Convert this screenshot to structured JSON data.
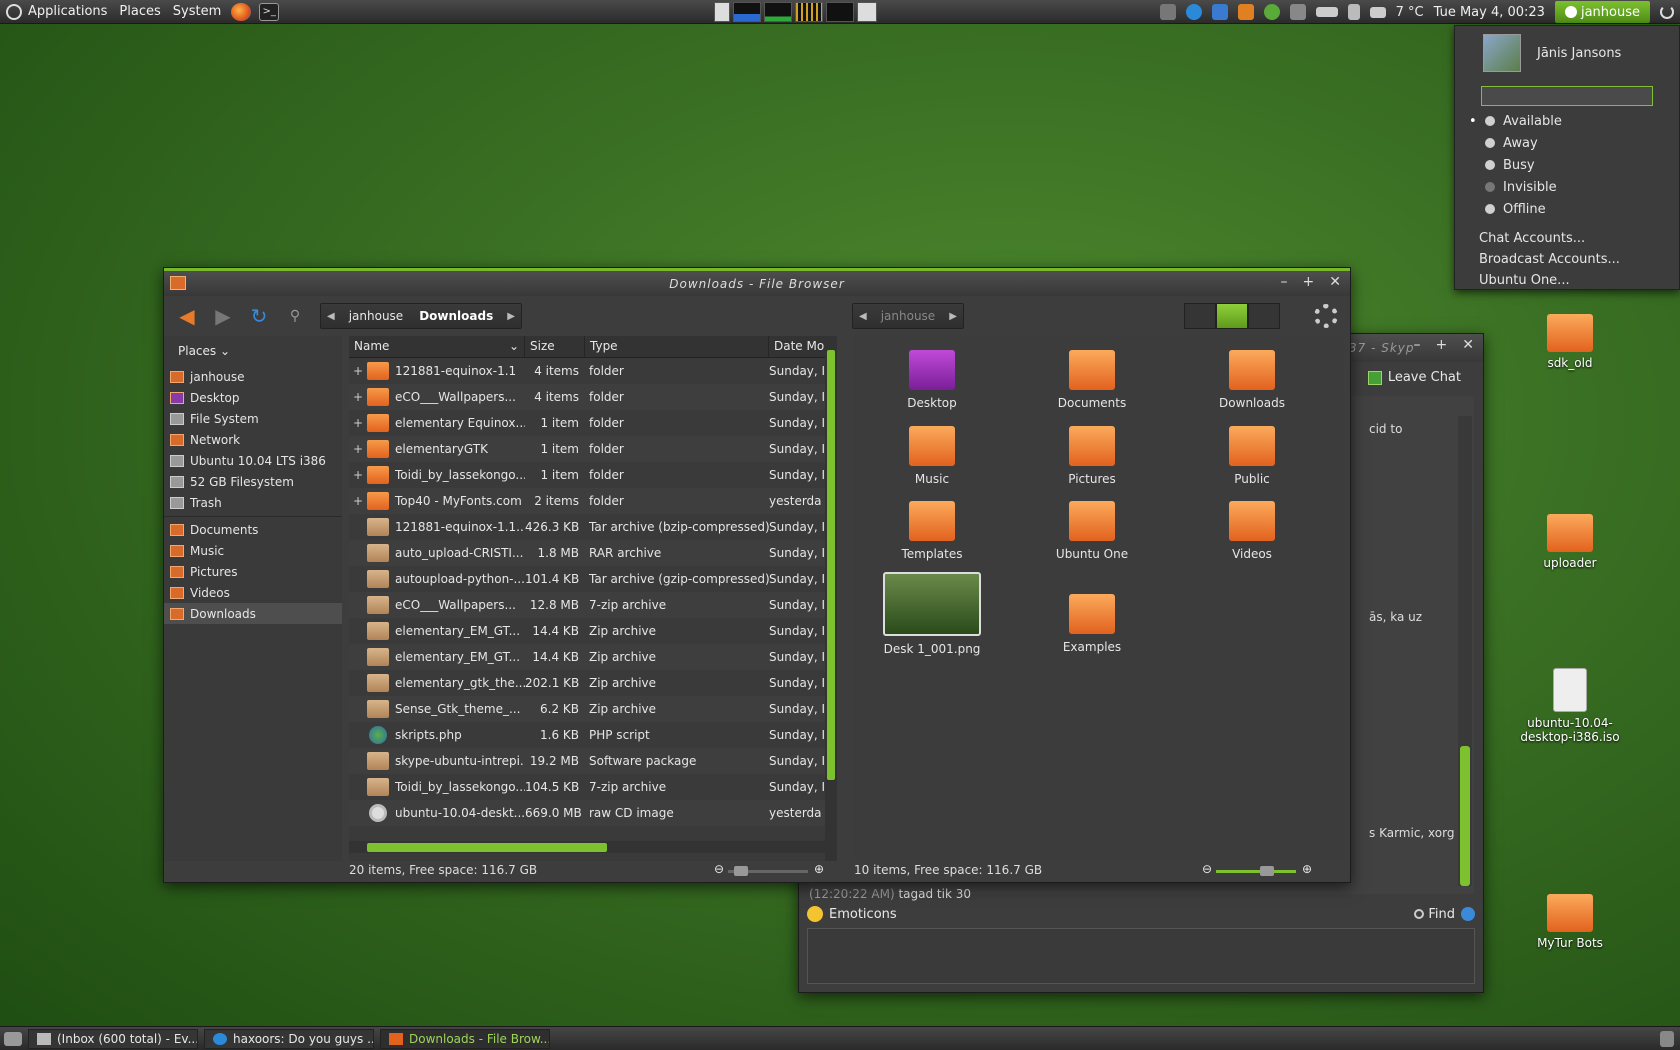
{
  "top_panel": {
    "menus": [
      "Applications",
      "Places",
      "System"
    ],
    "temperature": "7 °C",
    "clock": "Tue May 4, 00:23",
    "user": "janhouse"
  },
  "status_menu": {
    "name": "Jānis Jansons",
    "input_value": "",
    "statuses": [
      "Available",
      "Away",
      "Busy",
      "Invisible",
      "Offline"
    ],
    "selected_status": "Available",
    "links": [
      "Chat Accounts...",
      "Broadcast Accounts...",
      "Ubuntu One..."
    ]
  },
  "skype": {
    "title_fragment": "37 - Skyp",
    "leave_chat": "Leave Chat",
    "snippets": [
      "cid to",
      "ās, ka uz",
      "s Karmic, xorg"
    ],
    "timestamp": "(12:20:22 AM)",
    "last_message": "tagad tik 30",
    "emoticons": "Emoticons",
    "find": "Find"
  },
  "file_browser": {
    "title": "Downloads - File Browser",
    "breadcrumb_left": [
      "janhouse",
      "Downloads"
    ],
    "breadcrumb_right": [
      "janhouse"
    ],
    "places_label": "Places",
    "places": [
      {
        "label": "janhouse",
        "icon": "home-folder-icon"
      },
      {
        "label": "Desktop",
        "icon": "desktop-folder-icon"
      },
      {
        "label": "File System",
        "icon": "filesystem-icon"
      },
      {
        "label": "Network",
        "icon": "network-icon"
      },
      {
        "label": "Ubuntu 10.04 LTS i386",
        "icon": "drive-icon"
      },
      {
        "label": "52 GB Filesystem",
        "icon": "drive-icon"
      },
      {
        "label": "Trash",
        "icon": "trash-icon"
      }
    ],
    "bookmarks": [
      {
        "label": "Documents"
      },
      {
        "label": "Music"
      },
      {
        "label": "Pictures"
      },
      {
        "label": "Videos"
      },
      {
        "label": "Downloads"
      }
    ],
    "columns": [
      "Name",
      "Size",
      "Type",
      "Date Mo"
    ],
    "rows": [
      {
        "name": "121881-equinox-1.1",
        "size": "4 items",
        "type": "folder",
        "date": "Sunday, I",
        "kind": "folder"
      },
      {
        "name": "eCO___Wallpapers...",
        "size": "4 items",
        "type": "folder",
        "date": "Sunday, I",
        "kind": "folder"
      },
      {
        "name": "elementary Equinox...",
        "size": "1 item",
        "type": "folder",
        "date": "Sunday, I",
        "kind": "folder"
      },
      {
        "name": "elementaryGTK",
        "size": "1 item",
        "type": "folder",
        "date": "Sunday, I",
        "kind": "folder"
      },
      {
        "name": "Toidi_by_lassekongo...",
        "size": "1 item",
        "type": "folder",
        "date": "Sunday, I",
        "kind": "folder"
      },
      {
        "name": "Top40 - MyFonts.com",
        "size": "2 items",
        "type": "folder",
        "date": "yesterda",
        "kind": "folder"
      },
      {
        "name": "121881-equinox-1.1....",
        "size": "426.3 KB",
        "type": "Tar archive (bzip-compressed)",
        "date": "Sunday, I",
        "kind": "archive"
      },
      {
        "name": "auto_upload-CRISTI...",
        "size": "1.8 MB",
        "type": "RAR archive",
        "date": "Sunday, I",
        "kind": "archive"
      },
      {
        "name": "autoupload-python-...",
        "size": "101.4 KB",
        "type": "Tar archive (gzip-compressed)",
        "date": "Sunday, I",
        "kind": "archive"
      },
      {
        "name": "eCO___Wallpapers...",
        "size": "12.8 MB",
        "type": "7-zip archive",
        "date": "Sunday, I",
        "kind": "archive"
      },
      {
        "name": "elementary_EM_GT...",
        "size": "14.4 KB",
        "type": "Zip archive",
        "date": "Sunday, I",
        "kind": "archive"
      },
      {
        "name": "elementary_EM_GT...",
        "size": "14.4 KB",
        "type": "Zip archive",
        "date": "Sunday, I",
        "kind": "archive"
      },
      {
        "name": "elementary_gtk_the...",
        "size": "202.1 KB",
        "type": "Zip archive",
        "date": "Sunday, I",
        "kind": "archive"
      },
      {
        "name": "Sense_Gtk_theme_...",
        "size": "6.2 KB",
        "type": "Zip archive",
        "date": "Sunday, I",
        "kind": "archive"
      },
      {
        "name": "skripts.php",
        "size": "1.6 KB",
        "type": "PHP script",
        "date": "Sunday, I",
        "kind": "php"
      },
      {
        "name": "skype-ubuntu-intrepi...",
        "size": "19.2 MB",
        "type": "Software package",
        "date": "Sunday, I",
        "kind": "archive"
      },
      {
        "name": "Toidi_by_lassekongo...",
        "size": "104.5 KB",
        "type": "7-zip archive",
        "date": "Sunday, I",
        "kind": "archive"
      },
      {
        "name": "ubuntu-10.04-deskt...",
        "size": "669.0 MB",
        "type": "raw CD image",
        "date": "yesterda",
        "kind": "cd"
      }
    ],
    "status_left": "20 items, Free space: 116.7 GB",
    "status_right": "10 items, Free space: 116.7 GB",
    "icon_items": [
      "Desktop",
      "Documents",
      "Downloads",
      "Music",
      "Pictures",
      "Public",
      "Templates",
      "Ubuntu One",
      "Videos",
      "Desk 1_001.png",
      "Examples"
    ]
  },
  "desktop_icons": [
    "sdk_old",
    "uploader",
    "ubuntu-10.04-desktop-i386.iso",
    "MyTur Bots"
  ],
  "taskbar": [
    "(Inbox (600 total) - Ev...",
    "haxoors: Do you guys ...",
    "Downloads - File Brow..."
  ],
  "colors": {
    "accent": "#7ec12f",
    "folder": "#e2621e"
  }
}
